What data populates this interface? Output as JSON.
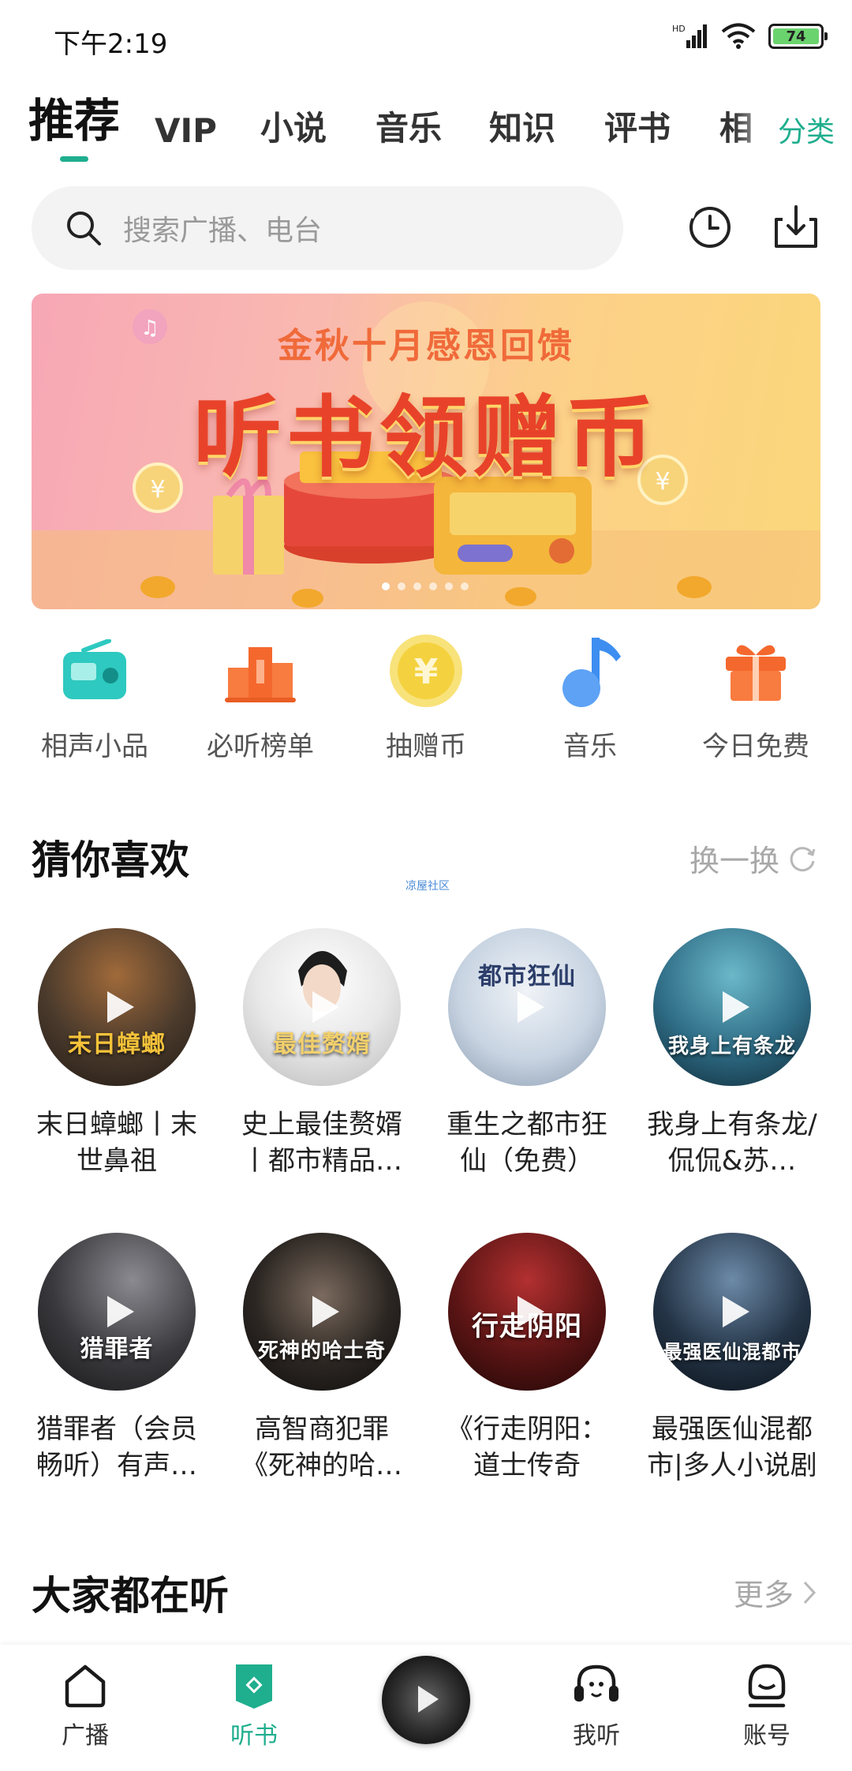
{
  "status": {
    "time": "下午2:19",
    "network": "HD",
    "battery": "74"
  },
  "tabs": [
    {
      "label": "推荐",
      "active": true
    },
    {
      "label": "VIP"
    },
    {
      "label": "小说"
    },
    {
      "label": "音乐"
    },
    {
      "label": "知识"
    },
    {
      "label": "评书"
    },
    {
      "label": "相"
    }
  ],
  "category_link": "分类",
  "search": {
    "placeholder": "搜索广播、电台"
  },
  "banner": {
    "subtitle": "金秋十月感恩回馈",
    "title": "听书领赠币",
    "pages": 6,
    "current_page": 1
  },
  "quick_links": [
    {
      "label": "相声小品",
      "icon": "radio-icon",
      "color": "#2ec9c0"
    },
    {
      "label": "必听榜单",
      "icon": "podium-icon",
      "color": "#f4682d"
    },
    {
      "label": "抽赠币",
      "icon": "yen-coin-icon",
      "color": "#f4d94a"
    },
    {
      "label": "音乐",
      "icon": "music-note-icon",
      "color": "#3d8ef0"
    },
    {
      "label": "今日免费",
      "icon": "gift-icon",
      "color": "#f4682d"
    }
  ],
  "recommend": {
    "title": "猜你喜欢",
    "refresh_label": "换一换",
    "watermark": "凉屋社区",
    "items": [
      {
        "title": "末日蟑螂丨末世鼻祖",
        "cover_text": "末日蟑螂",
        "cover_color": "#4a3a2c"
      },
      {
        "title": "史上最佳赘婿丨都市精品…",
        "cover_text": "最佳赘婿",
        "cover_color": "#e8e8e8"
      },
      {
        "title": "重生之都市狂仙（免费）",
        "cover_text": "都市狂仙",
        "cover_color": "#c8d4e2"
      },
      {
        "title": "我身上有条龙/侃侃&苏…",
        "cover_text": "我身上有条龙",
        "cover_color": "#2f6d86"
      },
      {
        "title": "猎罪者（会员畅听）有声…",
        "cover_text": "猎罪者",
        "cover_color": "#3a3a3e"
      },
      {
        "title": "高智商犯罪《死神的哈…",
        "cover_text": "死神的哈士奇",
        "cover_color": "#2b2622"
      },
      {
        "title": "《行走阴阳：道士传奇（）…",
        "cover_text": "行走阴阳",
        "cover_color": "#5a1414"
      },
      {
        "title": "最强医仙混都市|多人小说剧",
        "cover_text": "最强医仙混都市",
        "cover_color": "#243446"
      }
    ]
  },
  "popular": {
    "title": "大家都在听",
    "more_label": "更多"
  },
  "bottom_nav": [
    {
      "label": "广播",
      "icon": "home-icon",
      "active": false
    },
    {
      "label": "听书",
      "icon": "book-tag-icon",
      "active": true
    },
    {
      "label": "我听",
      "icon": "headphones-icon",
      "active": false
    },
    {
      "label": "账号",
      "icon": "account-face-icon",
      "active": false
    }
  ],
  "colors": {
    "accent": "#1fae8e",
    "text": "#1a1a1a",
    "muted": "#a8a8a8"
  }
}
